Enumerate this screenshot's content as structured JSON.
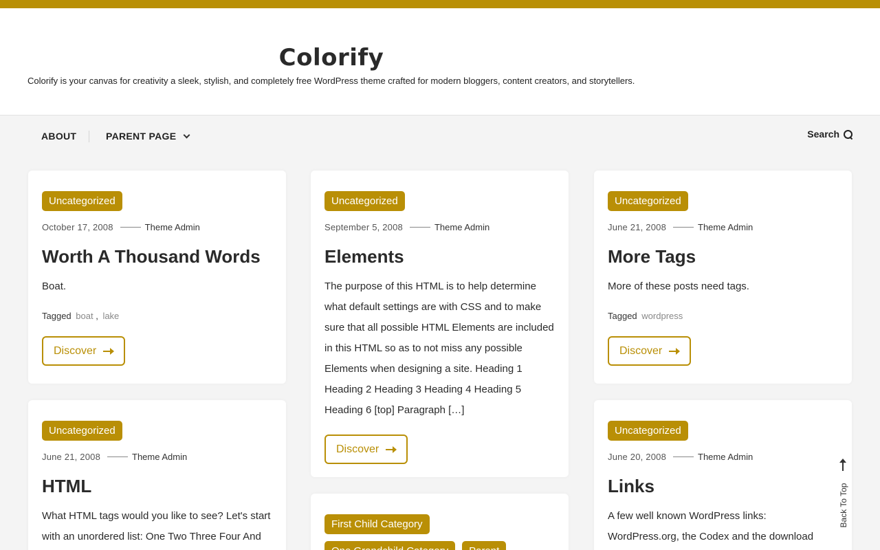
{
  "site": {
    "title": "Colorify",
    "description": "Colorify is your canvas for creativity a sleek, stylish, and completely free WordPress theme crafted for modern bloggers, content creators, and storytellers."
  },
  "nav": {
    "items": [
      {
        "label": "ABOUT"
      },
      {
        "label": "PARENT PAGE",
        "has_dropdown": true
      }
    ],
    "search_label": "Search"
  },
  "posts": [
    {
      "categories": [
        "Uncategorized"
      ],
      "date": "October 17, 2008",
      "author": "Theme Admin",
      "title": "Worth A Thousand Words",
      "excerpt": "Boat.",
      "tagged_label": "Tagged",
      "tags": [
        "boat",
        "lake"
      ],
      "cta": "Discover"
    },
    {
      "categories": [
        "Uncategorized"
      ],
      "date": "September 5, 2008",
      "author": "Theme Admin",
      "title": "Elements",
      "excerpt": "The purpose of this HTML is to help determine what default settings are with CSS and to make sure that all possible HTML Elements are included in this HTML so as to not miss any possible Elements when designing a site. Heading 1 Heading 2 Heading 3 Heading 4 Heading 5 Heading 6 [top] Paragraph […]",
      "cta": "Discover"
    },
    {
      "categories": [
        "Uncategorized"
      ],
      "date": "June 21, 2008",
      "author": "Theme Admin",
      "title": "More Tags",
      "excerpt": "More of these posts need tags.",
      "tagged_label": "Tagged",
      "tags": [
        "wordpress"
      ],
      "cta": "Discover"
    },
    {
      "categories": [
        "Uncategorized"
      ],
      "date": "June 21, 2008",
      "author": "Theme Admin",
      "title": "HTML",
      "excerpt": "What HTML tags would you like to see? Let's start with an unordered list: One Two Three Four And"
    },
    {
      "categories": [
        "First Child Category",
        "One Grandchild Category",
        "Parent"
      ]
    },
    {
      "categories": [
        "Uncategorized"
      ],
      "date": "June 20, 2008",
      "author": "Theme Admin",
      "title": "Links",
      "excerpt": "A few well known WordPress links: WordPress.org, the Codex and the download"
    }
  ],
  "back_to_top": "Back To Top",
  "colors": {
    "accent": "#b98f06",
    "background": "#f4f4f4",
    "card": "#ffffff"
  }
}
